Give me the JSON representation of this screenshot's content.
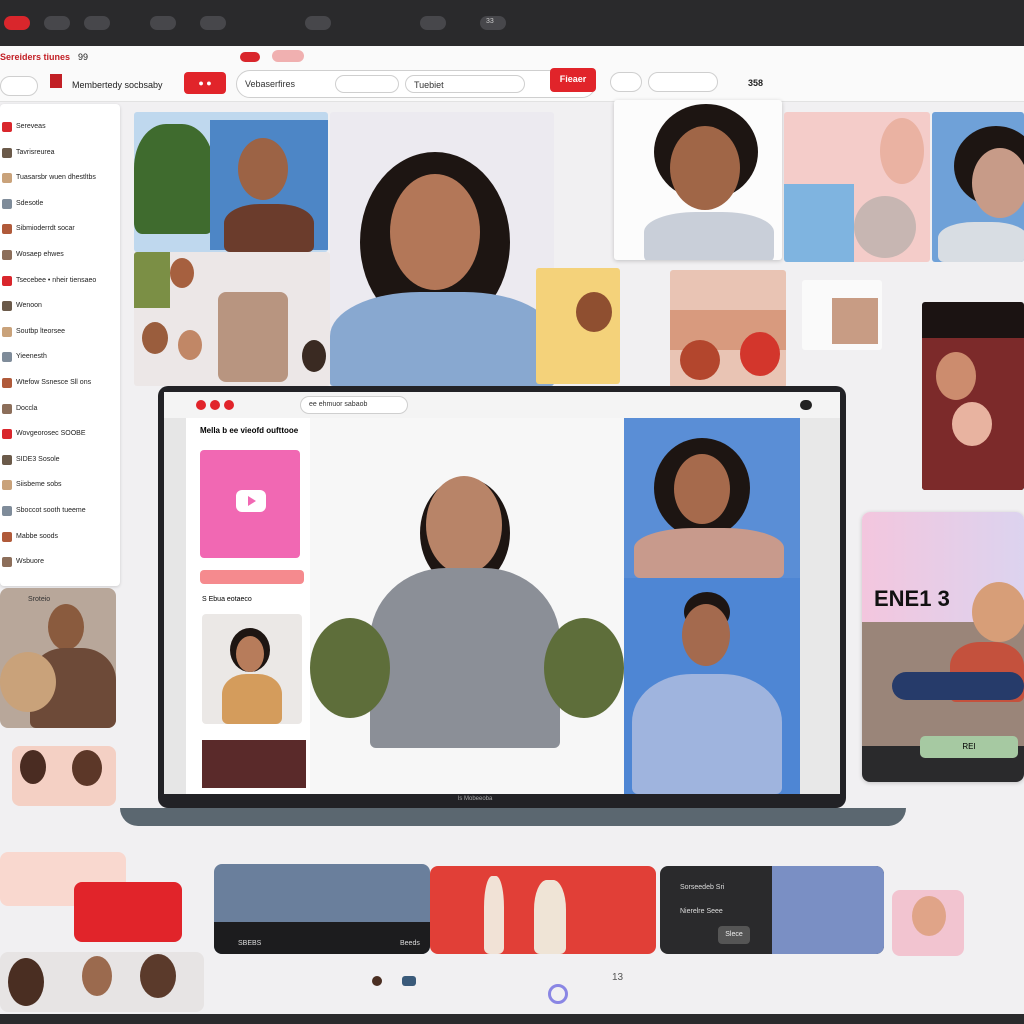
{
  "os_bar": {
    "label": "33"
  },
  "nav": {
    "brand": "Sereiders tiunes",
    "brand_count": "99",
    "tab_1": "Membertedy socbsaby",
    "search_pill": "Vebaserfires",
    "search_input_placeholder": "Tuebiet",
    "primary_button": "Fieaer",
    "count": "358"
  },
  "sidebar": {
    "items": [
      {
        "label": "Sereveas"
      },
      {
        "label": "Tavrisreurea"
      },
      {
        "label": "Tuasarsbr wuen dhestltbs"
      },
      {
        "label": "Sdesotle"
      },
      {
        "label": "Sibmioderrdt socar"
      },
      {
        "label": "Wosaep ehwes"
      },
      {
        "label": "Tsecebee • nheir tiensaeo"
      },
      {
        "label": "Wenoon"
      },
      {
        "label": "Soutbp lteorsee"
      },
      {
        "label": "Yieenesth"
      },
      {
        "label": "Wtefow Ssnesce Sll ons"
      },
      {
        "label": "Doccla"
      },
      {
        "label": "Wovgeorosec SOOBE"
      },
      {
        "label": "SIDE3 Sosole"
      },
      {
        "label": "Siisbeme sobs"
      },
      {
        "label": "Sboccot sooth tueeme"
      },
      {
        "label": "Mabbe soods"
      },
      {
        "label": "Wsbuore"
      }
    ]
  },
  "left_card": {
    "caption": "Sroteio"
  },
  "laptop": {
    "window_title": "ee ehmuor sabaob",
    "panel_title": "Mella b ee vieofd oufttooe",
    "upload_bar": "",
    "section_label": "S Ebua eotaeco",
    "brand": "ls Mobeeoba"
  },
  "right_card": {
    "banner_text": "ENE1 3",
    "button_label": "REI"
  },
  "bottom_strip": {
    "label_left": "SBEBS",
    "label_right": "Beeds",
    "dark_title": "Sorseedeb Sri",
    "dark_sub": "Nierelre Seee",
    "dark_button": "Slece"
  },
  "footer": {
    "number": "13"
  },
  "colors": {
    "accent": "#e1242a",
    "pink": "#f168b3",
    "blue": "#5b8ed8",
    "dark": "#2a2a2c"
  }
}
